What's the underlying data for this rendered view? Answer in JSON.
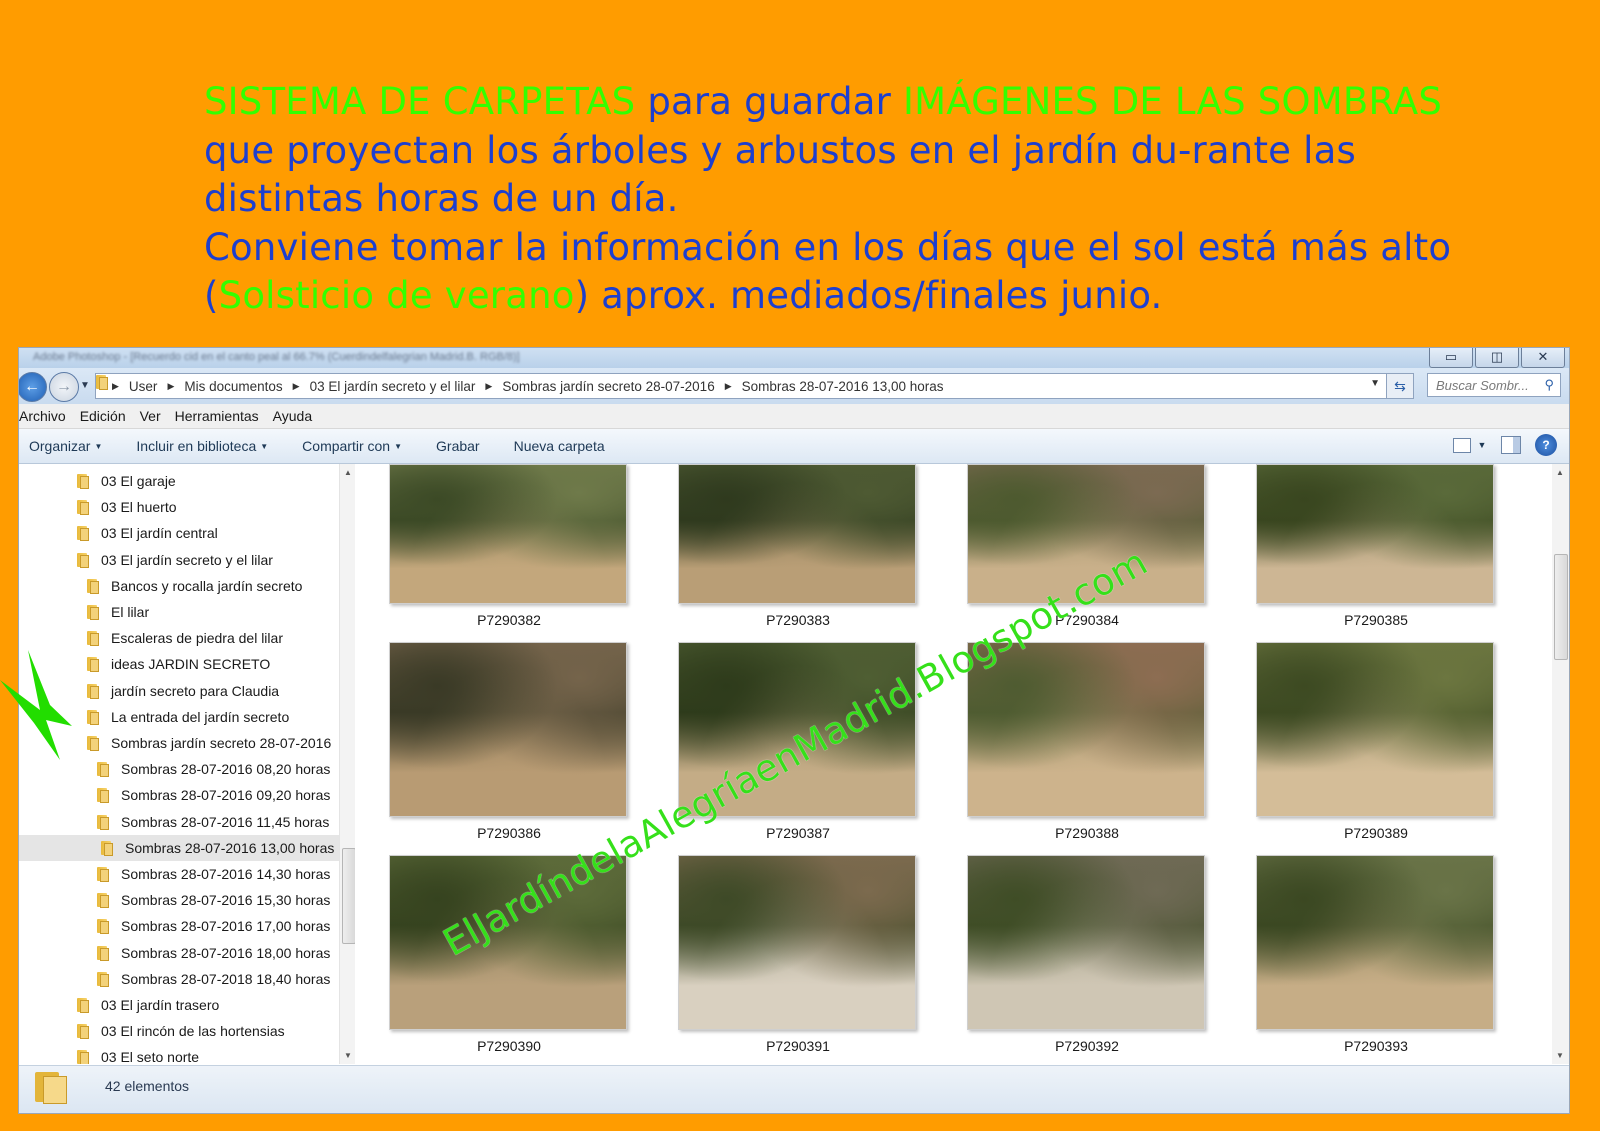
{
  "heading": {
    "part1_green": "SISTEMA DE CARPETAS",
    "part2_blue": " para guardar ",
    "part3_green": "IMÁGENES DE LAS SOMBRAS",
    "part4_blue": " que proyectan los árboles y arbustos en el jardín du-rante las distintas horas de un día.",
    "line2_blue_a": "Conviene tomar la información en los días que el sol está más alto",
    "line2_paren_open": "(",
    "line2_green": "Solsticio de verano",
    "line2_blue_b": ") aprox. mediados/finales junio."
  },
  "window": {
    "title_blurred": "Adobe Photoshop - [Recuerdo cid en el canto peal al 66.7% (Cuerdindelfalegrian Madrid.B. RGB/8)]",
    "controls": {
      "minimize": "▭",
      "maximize": "◫",
      "close": "✕"
    }
  },
  "address": {
    "crumbs": [
      "User",
      "Mis documentos",
      "03 El jardín secreto y el lilar",
      "Sombras jardín secreto 28-07-2016",
      "Sombras 28-07-2016 13,00 horas"
    ],
    "search_placeholder": "Buscar Sombr...",
    "icons": {
      "back": "arrow-left-icon",
      "forward": "arrow-right-icon",
      "refresh": "refresh-icon",
      "search": "search-icon"
    }
  },
  "menu": [
    "Archivo",
    "Edición",
    "Ver",
    "Herramientas",
    "Ayuda"
  ],
  "toolbar": {
    "organize": "Organizar",
    "include": "Incluir en biblioteca",
    "share": "Compartir con",
    "burn": "Grabar",
    "new_folder": "Nueva carpeta"
  },
  "tree": [
    {
      "label": "03 El garaje",
      "level": 0
    },
    {
      "label": "03 El huerto",
      "level": 0
    },
    {
      "label": "03 El jardín central",
      "level": 0
    },
    {
      "label": "03 El jardín secreto y el lilar",
      "level": 0
    },
    {
      "label": "Bancos y rocalla jardín secreto",
      "level": 1
    },
    {
      "label": "El lilar",
      "level": 1
    },
    {
      "label": "Escaleras de piedra del lilar",
      "level": 1
    },
    {
      "label": "ideas JARDIN SECRETO",
      "level": 1
    },
    {
      "label": "jardín secreto para Claudia",
      "level": 1
    },
    {
      "label": "La entrada del jardín secreto",
      "level": 1
    },
    {
      "label": "Sombras jardín secreto 28-07-2016",
      "level": 1
    },
    {
      "label": "Sombras 28-07-2016 08,20 horas",
      "level": 2
    },
    {
      "label": "Sombras 28-07-2016 09,20 horas",
      "level": 2
    },
    {
      "label": "Sombras 28-07-2016 11,45 horas",
      "level": 2
    },
    {
      "label": "Sombras 28-07-2016 13,00 horas",
      "level": 2,
      "selected": true
    },
    {
      "label": "Sombras 28-07-2016 14,30 horas",
      "level": 2
    },
    {
      "label": "Sombras 28-07-2016 15,30 horas",
      "level": 2
    },
    {
      "label": "Sombras 28-07-2016 17,00 horas",
      "level": 2
    },
    {
      "label": "Sombras 28-07-2016 18,00 horas",
      "level": 2
    },
    {
      "label": "Sombras 28-07-2018 18,40 horas",
      "level": 2
    },
    {
      "label": "03 El jardín trasero",
      "level": 0
    },
    {
      "label": "03 El rincón de las hortensias",
      "level": 0
    },
    {
      "label": "03 El seto norte",
      "level": 0
    }
  ],
  "files": [
    {
      "name": "P7290382",
      "palette": [
        "#6f7a4a",
        "#c3a77c",
        "#3c4a26"
      ]
    },
    {
      "name": "P7290383",
      "palette": [
        "#4e5a33",
        "#b99e76",
        "#2f3a1e"
      ]
    },
    {
      "name": "P7290384",
      "palette": [
        "#7c6a52",
        "#c9b08a",
        "#4d5a2f"
      ]
    },
    {
      "name": "P7290385",
      "palette": [
        "#5a6a3a",
        "#cdb694",
        "#39461f"
      ]
    },
    {
      "name": "P7290386",
      "palette": [
        "#75644b",
        "#b89b73",
        "#3a3a26"
      ]
    },
    {
      "name": "P7290387",
      "palette": [
        "#4f5e33",
        "#c4ac86",
        "#2e3b1b"
      ]
    },
    {
      "name": "P7290388",
      "palette": [
        "#8d6d52",
        "#cdb38c",
        "#4f5c31"
      ]
    },
    {
      "name": "P7290389",
      "palette": [
        "#6c7640",
        "#d4bd98",
        "#3d4a22"
      ]
    },
    {
      "name": "P7290390",
      "palette": [
        "#5d6b3a",
        "#b9a07b",
        "#36431f"
      ]
    },
    {
      "name": "P7290391",
      "palette": [
        "#7c6a4e",
        "#d9d0c0",
        "#3e4a27"
      ]
    },
    {
      "name": "P7290392",
      "palette": [
        "#6f6a55",
        "#cfc6b4",
        "#3f4d26"
      ]
    },
    {
      "name": "P7290393",
      "palette": [
        "#6a7448",
        "#c6ad86",
        "#3b4822"
      ]
    }
  ],
  "status": {
    "count": "42 elementos"
  },
  "watermark": "ElJardíndelaAlegríaenMadrid.Blogspot.com",
  "colors": {
    "background": "#ff9c00",
    "heading_blue": "#1d3fcf",
    "heading_green": "#33ff00",
    "arrow_green": "#22dd00"
  }
}
